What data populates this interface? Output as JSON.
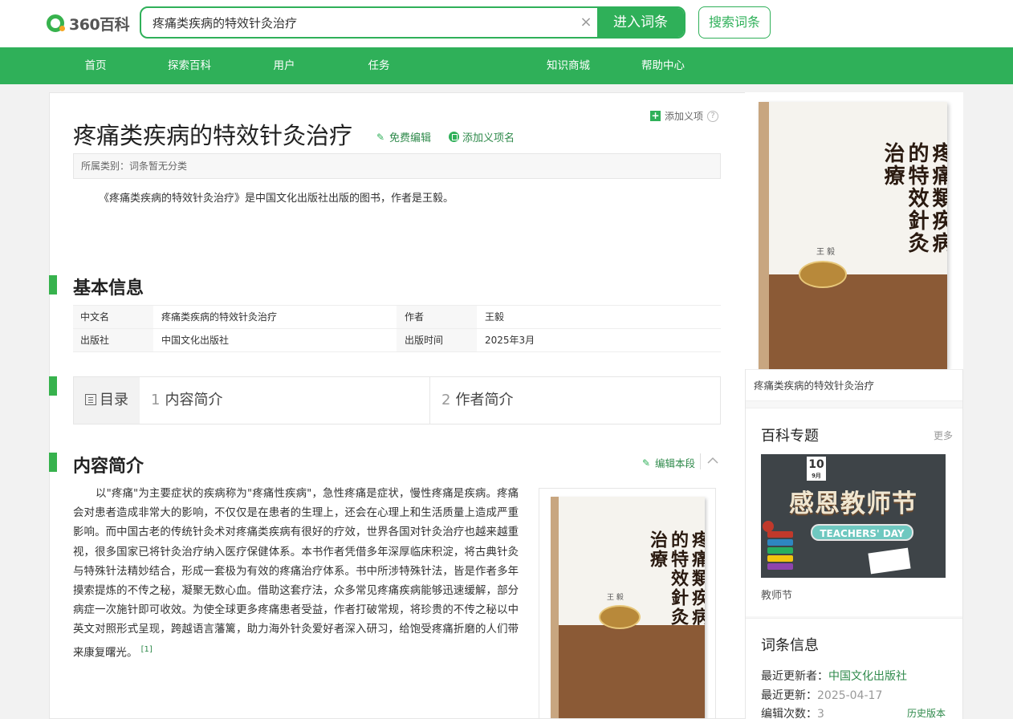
{
  "header": {
    "logo_text": "360百科",
    "search_value": "疼痛类疾病的特效针灸治疗",
    "clear_symbol": "×",
    "enter_label": "进入词条",
    "search_label": "搜索词条"
  },
  "nav": {
    "items": [
      "首页",
      "探索百科",
      "用户",
      "任务",
      "知识商城",
      "帮助中心"
    ]
  },
  "entry": {
    "title": "疼痛类疾病的特效针灸治疗",
    "edit_label": "免费编辑",
    "add_name_label": "添加义项名",
    "add_sense_label": "添加义项",
    "category": "所属类别：词条暂无分类",
    "summary": "《疼痛类疾病的特效针灸治疗》是中国文化出版社出版的图书，作者是王毅。"
  },
  "basic_info": {
    "heading": "基本信息",
    "rows": [
      {
        "label1": "中文名",
        "value1": "疼痛类疾病的特效针灸治疗",
        "label2": "作者",
        "value2": "王毅"
      },
      {
        "label1": "出版社",
        "value1": "中国文化出版社",
        "label2": "出版时间",
        "value2": "2025年3月"
      }
    ]
  },
  "toc": {
    "heading": "目录",
    "items": [
      {
        "num": "1",
        "label": "内容简介"
      },
      {
        "num": "2",
        "label": "作者简介"
      }
    ]
  },
  "content_section": {
    "heading": "内容简介",
    "edit_label": "编辑本段",
    "text": "以\"疼痛\"为主要症状的疾病称为\"疼痛性疾病\"，急性疼痛是症状，慢性疼痛是疾病。疼痛会对患者造成非常大的影响，不仅仅是在患者的生理上，还会在心理上和生活质量上造成严重影响。而中国古老的传统针灸术对疼痛类疾病有很好的疗效，世界各国对针灸治疗也越来越重视，很多国家已将针灸治疗纳入医疗保健体系。本书作者凭借多年深厚临床积淀，将古典针灸与特殊针法精妙结合，形成一套极为有效的疼痛治疗体系。书中所涉特殊针法，皆是作者多年摸索提炼的不传之秘，凝聚无数心血。借助这套疗法，众多常见疼痛疾病能够迅速缓解，部分病症一次施针即可收效。为使全球更多疼痛患者受益，作者打破常规，将珍贵的不传之秘以中英文对照形式呈现，跨越语言藩篱，助力海外针灸爱好者深入研习，给饱受疼痛折磨的人们带来康复曙光。",
    "ref": "[1]"
  },
  "cover": {
    "title_text": "疼痛類疾病的特效針灸治療",
    "author_mark": "王 毅"
  },
  "sidebar": {
    "image_caption": "疼痛类疾病的特效针灸治疗",
    "topics_heading": "百科专题",
    "topics_more": "更多",
    "banner_title": "感恩教师节",
    "banner_sub": "TEACHERS' DAY",
    "banner_date_num": "10",
    "banner_date_month": "9月",
    "banner_caption": "教师节",
    "entry_info_heading": "词条信息",
    "last_editor_label": "最近更新者：",
    "last_editor": "中国文化出版社",
    "last_update_label": "最近更新：",
    "last_update": "2025-04-17",
    "edit_count_label": "编辑次数：",
    "edit_count": "3",
    "history_label": "历史版本"
  },
  "colors": {
    "brand_green": "#2fb059",
    "link_green": "#2f8a4b",
    "cover_brown": "#8b5a36"
  }
}
